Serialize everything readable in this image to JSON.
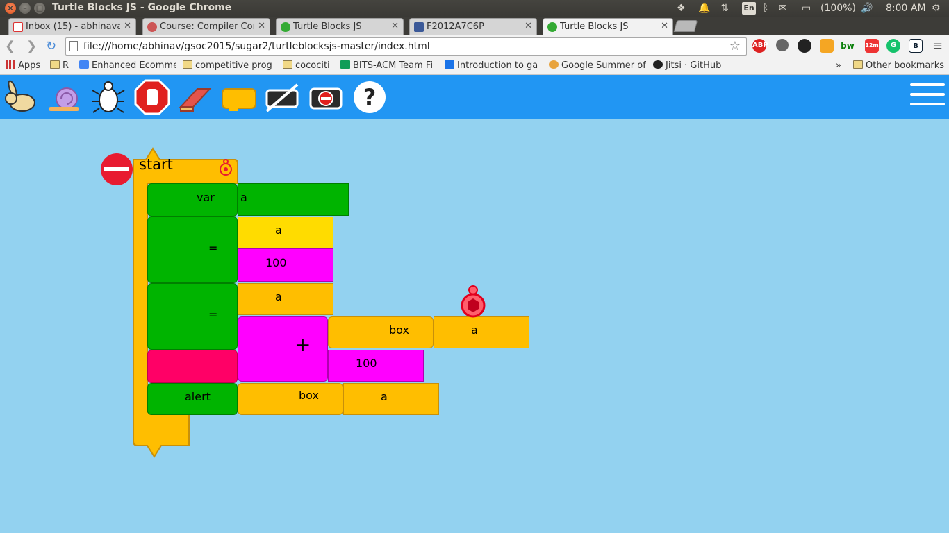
{
  "os": {
    "window_title": "Turtle Blocks JS - Google Chrome",
    "battery": "(100%)",
    "clock": "8:00 AM",
    "lang": "En"
  },
  "tabs": [
    {
      "label": "Inbox (15) - abhinavan",
      "icon_color": "#d33"
    },
    {
      "label": "Course: Compiler Con",
      "icon_color": "#c55"
    },
    {
      "label": "Turtle Blocks JS",
      "icon_color": "#3a3"
    },
    {
      "label": "F2012A7C6P",
      "icon_color": "#3b5998"
    },
    {
      "label": "Turtle Blocks JS",
      "icon_color": "#3a3"
    }
  ],
  "omnibox": {
    "url": "file:///home/abhinav/gsoc2015/sugar2/turtleblocksjs-master/index.html"
  },
  "extensions": [
    "ABP",
    "",
    "",
    "",
    "bw",
    "12m",
    "G",
    "B"
  ],
  "bookmarks": [
    {
      "label": "Apps"
    },
    {
      "label": "R"
    },
    {
      "label": "Enhanced Ecomme"
    },
    {
      "label": "competitive prog"
    },
    {
      "label": "cocociti"
    },
    {
      "label": "BITS-ACM Team Fi"
    },
    {
      "label": "Introduction to ga"
    },
    {
      "label": "Google Summer of"
    },
    {
      "label": "Jitsi · GitHub"
    },
    {
      "label": "»"
    },
    {
      "label": "Other bookmarks"
    }
  ],
  "app_tools": [
    "run-fast-icon",
    "run-slow-icon",
    "debug-step-icon",
    "stop-icon",
    "clear-icon",
    "palette-icon",
    "hide-blocks-icon",
    "collapse-blocks-icon",
    "help-icon"
  ],
  "blocks": {
    "start": "start",
    "var": "var",
    "var_value": "a",
    "eq1": "=",
    "eq1_name": "a",
    "eq1_value": "100",
    "eq2": "=",
    "eq2_name": "a",
    "plus": "+",
    "box1": "box",
    "box1_value": "a",
    "plus_value": "100",
    "alert": "alert",
    "box2": "box",
    "box2_value": "a"
  }
}
